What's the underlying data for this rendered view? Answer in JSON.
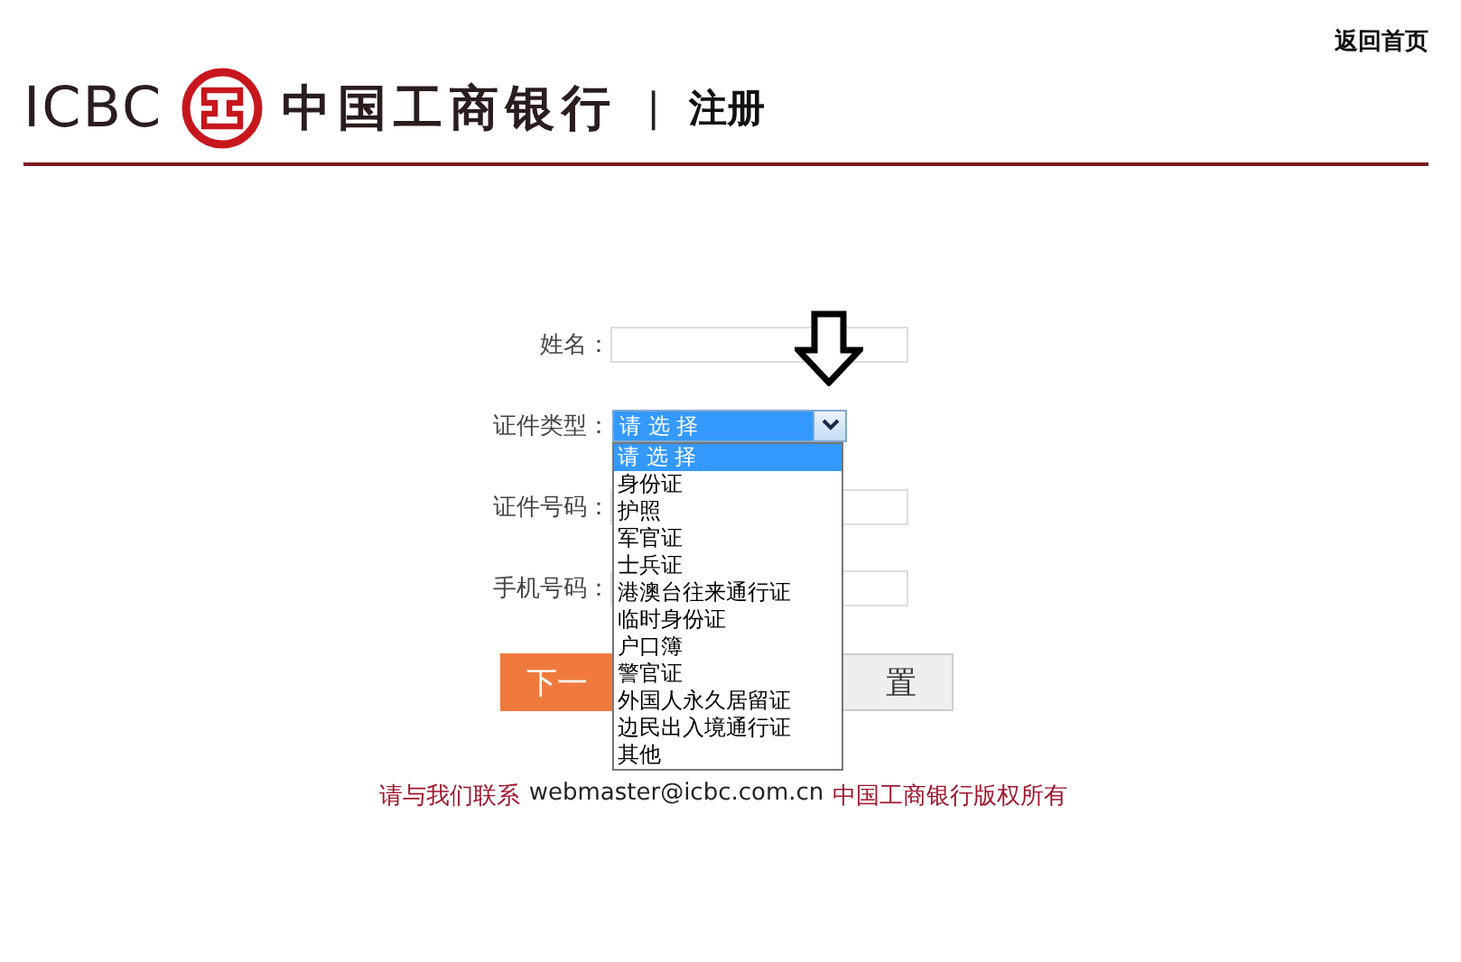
{
  "header": {
    "home_link": "返回首页",
    "logo_latin": "ICBC",
    "logo_chinese": "中国工商银行",
    "separator": "|",
    "page_title": "注册"
  },
  "form": {
    "fields": [
      {
        "label": "姓名：",
        "kind": "text"
      },
      {
        "label": "证件类型：",
        "kind": "select",
        "value": "请 选 择",
        "expanded": true,
        "options": [
          {
            "label": "请 选 择",
            "selected": true
          },
          {
            "label": "身份证",
            "selected": false
          },
          {
            "label": "护照",
            "selected": false
          },
          {
            "label": "军官证",
            "selected": false
          },
          {
            "label": "士兵证",
            "selected": false
          },
          {
            "label": "港澳台往来通行证",
            "selected": false
          },
          {
            "label": "临时身份证",
            "selected": false
          },
          {
            "label": "户口簿",
            "selected": false
          },
          {
            "label": "警官证",
            "selected": false
          },
          {
            "label": "外国人永久居留证",
            "selected": false
          },
          {
            "label": "边民出入境通行证",
            "selected": false
          },
          {
            "label": "其他",
            "selected": false
          }
        ]
      },
      {
        "label": "证件号码：",
        "kind": "text"
      },
      {
        "label": "手机号码：",
        "kind": "text"
      }
    ],
    "buttons": [
      {
        "label": "下一",
        "kind": "primary"
      },
      {
        "label": "置",
        "kind": "secondary"
      }
    ]
  },
  "footer": {
    "contact": "请与我们联系",
    "email": "webmaster@icbc.com.cn",
    "copyright": "中国工商银行版权所有"
  }
}
